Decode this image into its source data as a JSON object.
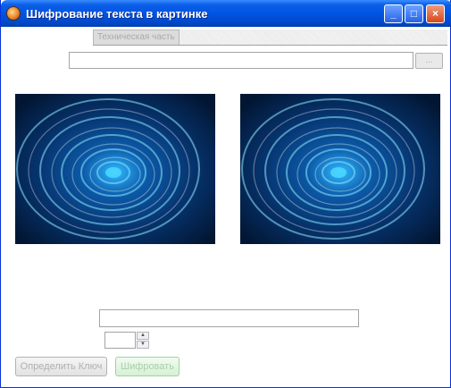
{
  "window": {
    "title": "Шифрование текста в картинке",
    "controls": {
      "minimize": "_",
      "maximize": "□",
      "close": "×"
    }
  },
  "tabs": [
    {
      "label": "Техническая часть"
    }
  ],
  "file_path": {
    "value": "",
    "button_label": "..."
  },
  "images": [
    {
      "name": "source-image"
    },
    {
      "name": "result-image"
    }
  ],
  "message_input": {
    "value": ""
  },
  "number_input": {
    "value": ""
  },
  "buttons": {
    "find_key": "Определить Ключ",
    "encrypt": "Шифровать"
  },
  "colors": {
    "titlebar": "#0054e3",
    "water_dark": "#031a3e",
    "water_mid": "#0b5aa8",
    "water_light": "#3fd0ff"
  }
}
